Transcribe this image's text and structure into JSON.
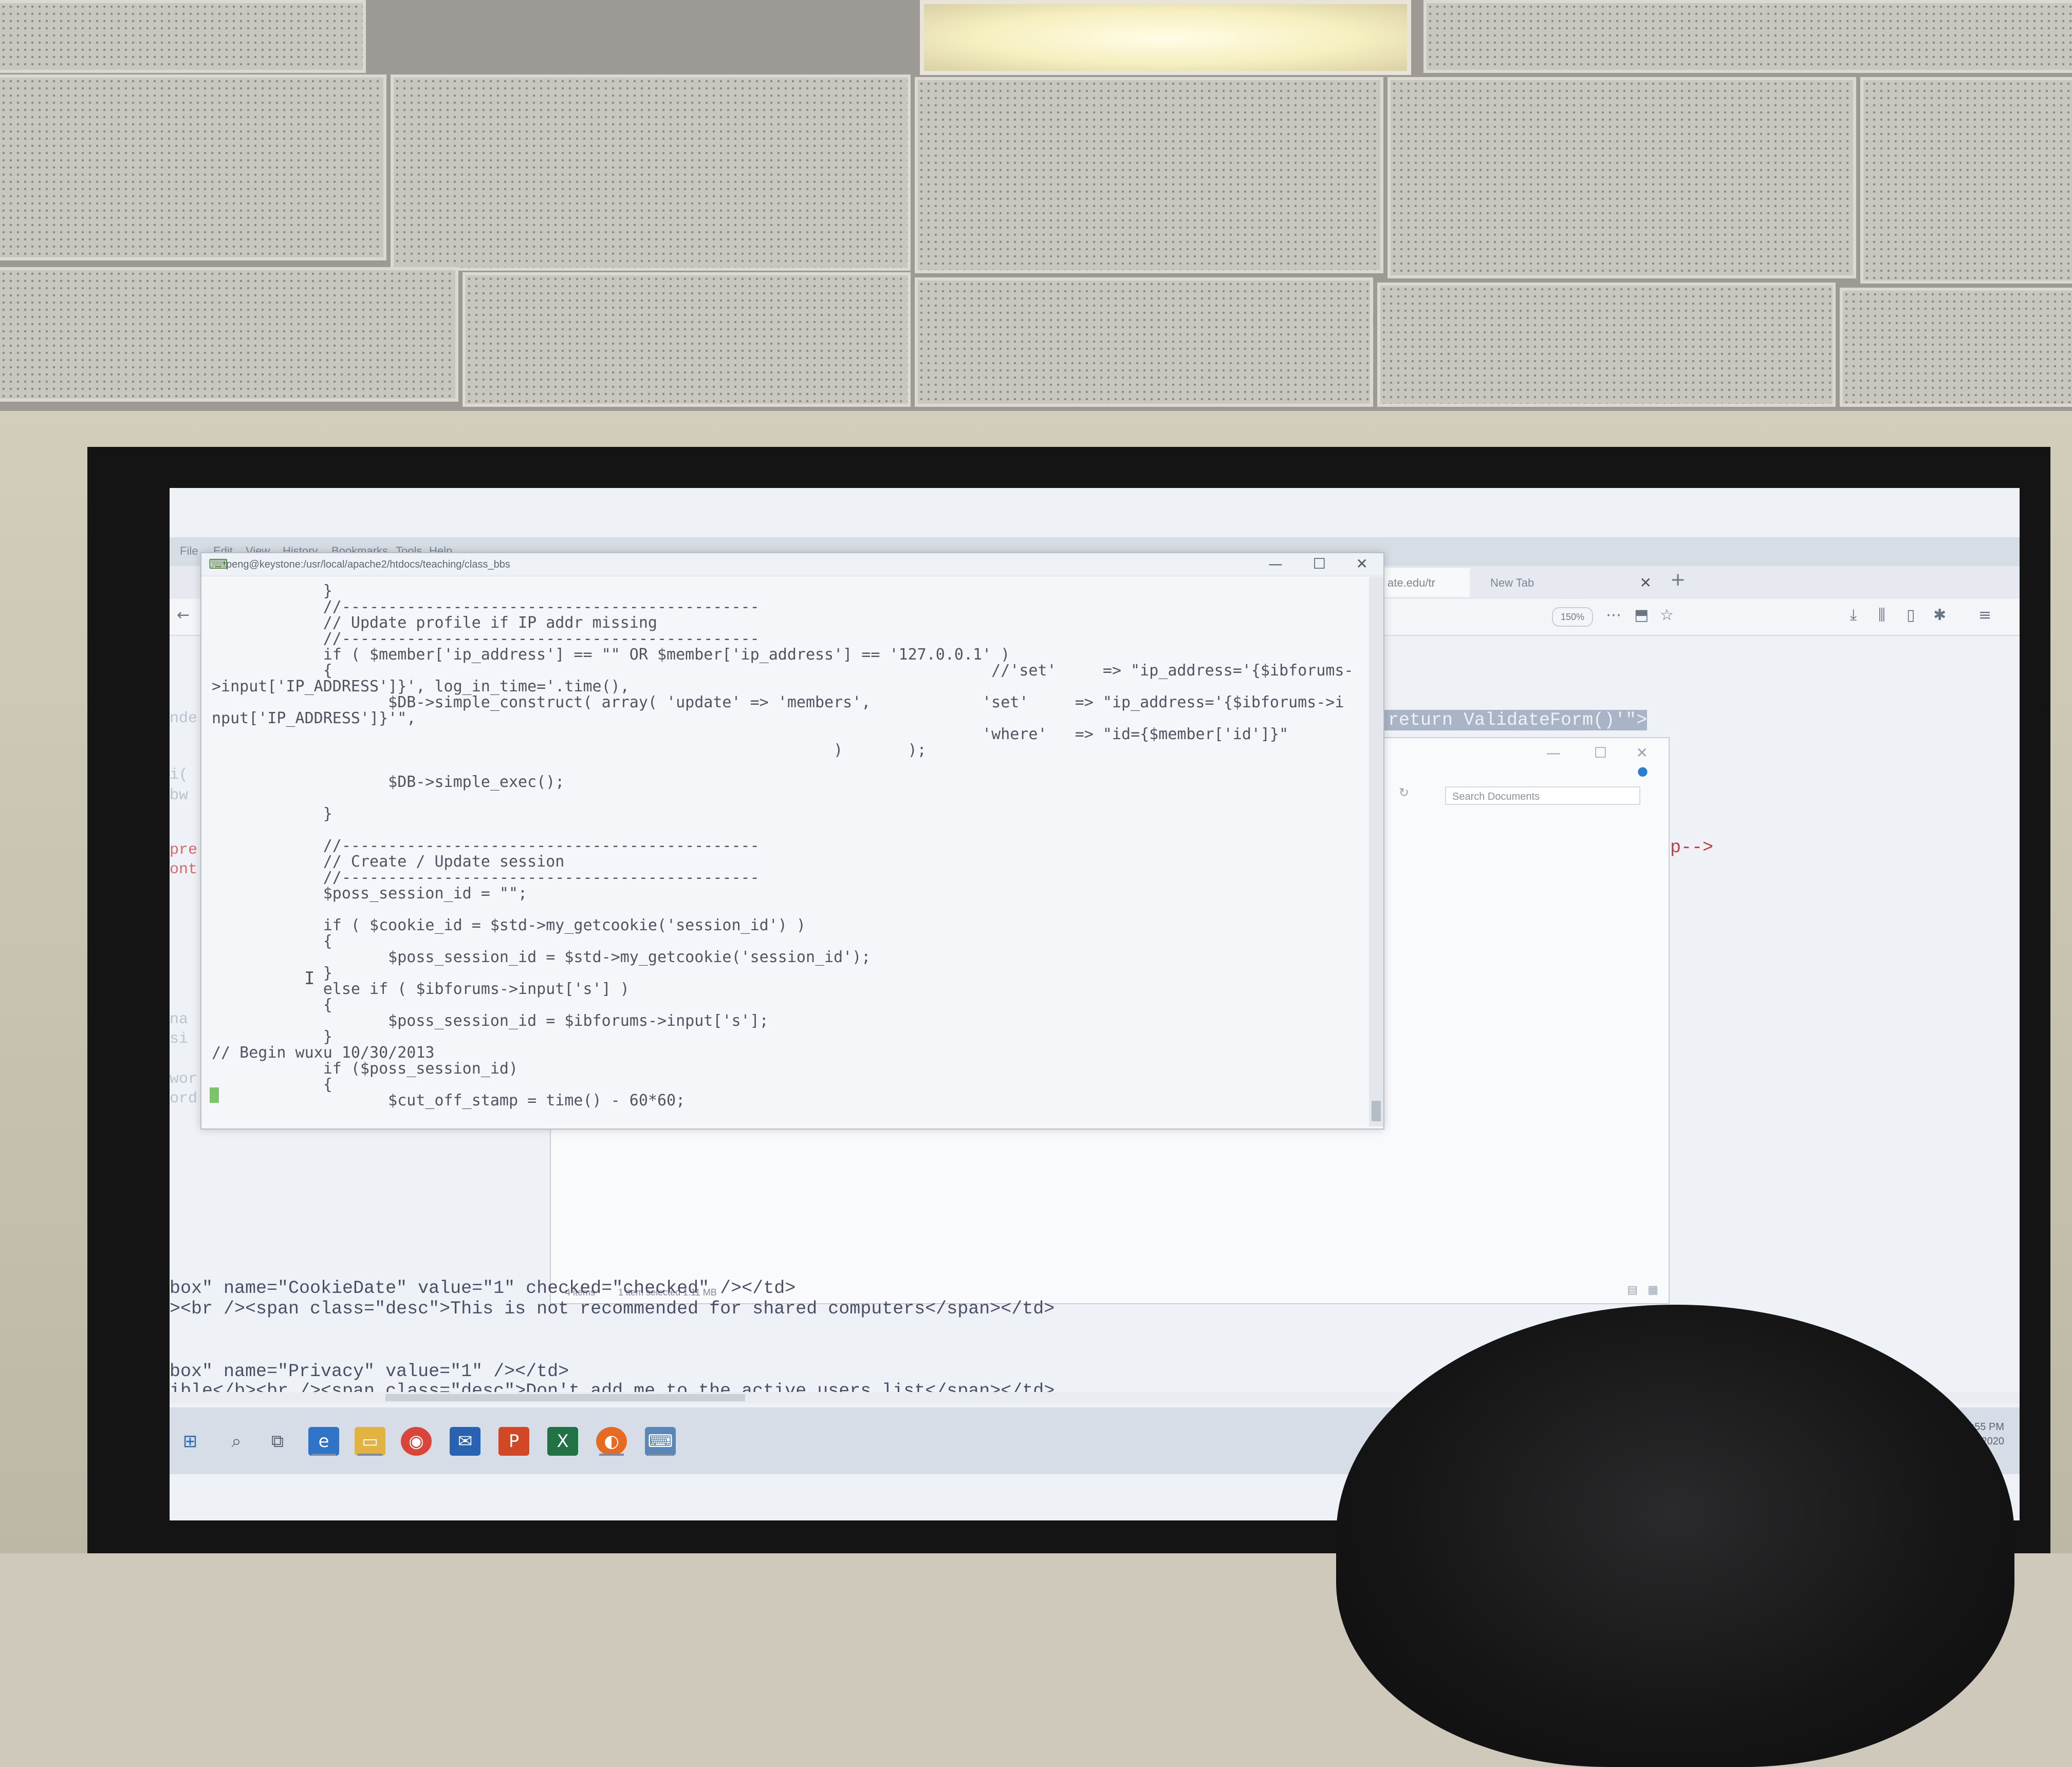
{
  "firefox": {
    "menu": [
      "File",
      "Edit",
      "View",
      "History",
      "Bookmarks",
      "Tools",
      "Help"
    ],
    "tabs": [
      {
        "label": "ate.edu/tr"
      },
      {
        "label": "New Tab"
      }
    ],
    "zoom": "150%"
  },
  "terminal": {
    "title": "peng@keystone:/usr/local/apache2/htdocs/teaching/class_bbs",
    "lines": [
      "            }",
      "            //---------------------------------------------",
      "            // Update profile if IP addr missing",
      "            //---------------------------------------------",
      "            if ( $member['ip_address'] == \"\" OR $member['ip_address'] == '127.0.0.1' )",
      "            {                                                                       //'set'     => \"ip_address='{$ibforums-",
      ">input['IP_ADDRESS']}', log_in_time='.time(),",
      "                   $DB->simple_construct( array( 'update' => 'members',            'set'     => \"ip_address='{$ibforums->i",
      "nput['IP_ADDRESS']}'\",",
      "                                                                                   'where'   => \"id={$member['id']}\"",
      "                                                                   )       );",
      "",
      "                   $DB->simple_exec();",
      "",
      "            }",
      "",
      "            //---------------------------------------------",
      "            // Create / Update session",
      "            //---------------------------------------------",
      "            $poss_session_id = \"\";",
      "",
      "            if ( $cookie_id = $std->my_getcookie('session_id') )",
      "            {",
      "                   $poss_session_id = $std->my_getcookie('session_id');",
      "            }",
      "            else if ( $ibforums->input['s'] )",
      "            {",
      "                   $poss_session_id = $ibforums->input['s'];",
      "            }",
      "// Begin wuxu 10/30/2013",
      "            if ($poss_session_id)",
      "            {",
      "                   $cut_off_stamp = time() - 60*60;"
    ]
  },
  "explorer": {
    "search_placeholder": "Search Documents",
    "status_items": "4 items",
    "status_selected": "1 item selected  1.11 MB"
  },
  "background_code": {
    "line_validate": "'return ValidateForm()'\">",
    "line_p_close": "</p-->",
    "line1": "box\" name=\"CookieDate\" value=\"1\" checked=\"checked\" /></td>",
    "line2": "><br /><span class=\"desc\">This is not recommended for shared computers</span></td>",
    "line3": "box\" name=\"Privacy\" value=\"1\" /></td>",
    "line4": "ible</b><br /><span class=\"desc\">Don't add me to the active users list</span></td>"
  },
  "taskbar": {
    "time": "6:55 PM",
    "date": "2/5/2020"
  }
}
